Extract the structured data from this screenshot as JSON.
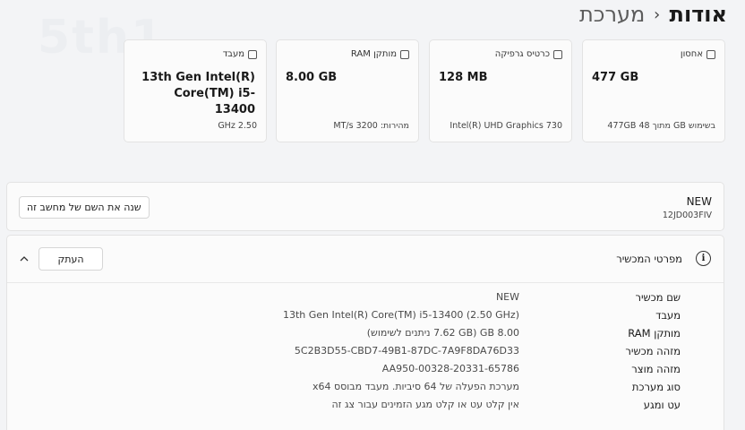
{
  "breadcrumb": {
    "parent": "מערכת",
    "separator": "›",
    "current": "אודות"
  },
  "cards": [
    {
      "id": "storage",
      "label": "אחסון",
      "icon": "hard-drive-icon",
      "value": "477 GB",
      "footer": "בשימוש GB  מתוך 477GB 48"
    },
    {
      "id": "gpu",
      "label": "כרטיס גרפיקה",
      "icon": "graphics-card-icon",
      "value": "128 MB",
      "footer": "Intel(R) UHD Graphics 730"
    },
    {
      "id": "ram",
      "label": "מותקן RAM",
      "icon": "memory-icon",
      "value": "8.00 GB",
      "footer": "מהירות: 3200 MT/s"
    },
    {
      "id": "cpu",
      "label": "מעבד",
      "icon": "processor-icon",
      "value": "13th Gen Intel(R) Core(TM) i5-13400",
      "footer": "2.50 GHz"
    }
  ],
  "device": {
    "name": "NEW",
    "model": "12JD003FIV",
    "rename_label": "שנה את השם של מחשב זה"
  },
  "specs": {
    "title": "מפרטי המכשיר",
    "copy_label": "העתק",
    "rows": [
      {
        "label": "שם מכשיר",
        "value": "NEW"
      },
      {
        "label": "מעבד",
        "value": "13th Gen Intel(R) Core(TM) i5-13400 (2.50 GHz)"
      },
      {
        "label": "מותקן RAM",
        "value": "8.00 GB (7.62 GB ניתנים לשימוש)"
      },
      {
        "label": "מזהה מכשיר",
        "value": "5C2B3D55-CBD7-49B1-87DC-7A9F8DA76D33"
      },
      {
        "label": "מזהה מוצר",
        "value": "00328-20331-65786-AA950"
      },
      {
        "label": "סוג מערכת",
        "value": "מערכת הפעלה של 64 סיביות. מעבד מבוסס x64"
      },
      {
        "label": "עט ומגע",
        "value": "אין קלט עט או קלט מגע הזמינים עבור צג זה"
      }
    ]
  }
}
